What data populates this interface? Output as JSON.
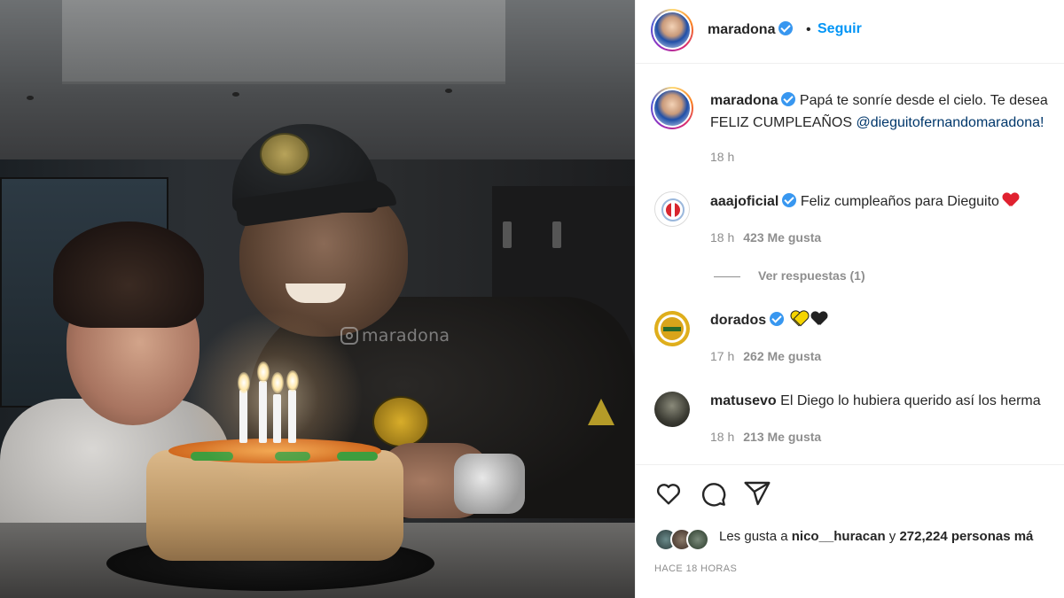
{
  "post": {
    "author": "maradona",
    "follow_label": "Seguir",
    "header_separator": "•",
    "photo_watermark": "maradona",
    "caption": {
      "username": "maradona",
      "text_line1": "Papá te sonríe desde el cielo. Te desea",
      "text_line2_prefix": "FELIZ CUMPLEAÑOS ",
      "mention": "@dieguitofernandomaradona!",
      "time": "18 h"
    },
    "comments": [
      {
        "username": "aaajoficial",
        "text": "Feliz cumpleaños para Dieguito",
        "time": "18 h",
        "likes": "423 Me gusta",
        "replies_label": "Ver respuestas (1)"
      },
      {
        "username": "dorados",
        "text": "",
        "time": "17 h",
        "likes": "262 Me gusta"
      },
      {
        "username": "matusevo",
        "text": "El Diego lo hubiera querido así los herma",
        "time": "18 h",
        "likes": "213 Me gusta"
      }
    ],
    "likes_summary": {
      "prefix": "Les gusta a ",
      "liker": "nico__huracan",
      "middle": " y ",
      "count": "272,224 personas má"
    },
    "posted_ago": "HACE 18 HORAS"
  },
  "icons": {
    "like": "heart-outline-icon",
    "comment": "comment-bubble-icon",
    "share": "paper-plane-icon",
    "verified": "verified-badge-icon"
  },
  "colors": {
    "link_blue": "#0095f6",
    "verified_blue": "#3897f0",
    "mention_blue": "#00376b",
    "muted_gray": "#8e8e8e"
  }
}
